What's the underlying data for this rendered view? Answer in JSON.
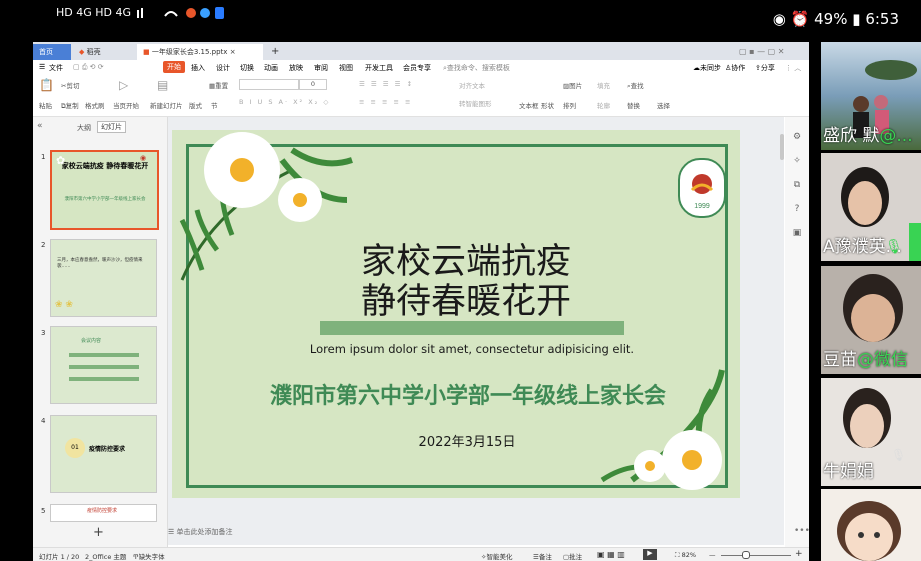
{
  "status_bar": {
    "left_icons": "HD 4G HD 4G",
    "battery": "49%",
    "time": "6:53"
  },
  "wps": {
    "tabs": [
      {
        "label": "首页"
      },
      {
        "label": "稻壳"
      },
      {
        "label": "一年级家长会3.15.pptx"
      }
    ],
    "new_tab": "+",
    "menu": [
      "文件",
      "开始",
      "插入",
      "设计",
      "切换",
      "动画",
      "放映",
      "审阅",
      "视图",
      "开发工具",
      "会员专享"
    ],
    "search_placeholder": "查找命令、搜索模板",
    "sync": "未同步",
    "collab": "协作",
    "share": "分享",
    "ribbon": {
      "paste": "粘贴",
      "cut": "剪切",
      "copy": "复制",
      "format_painter": "格式刷",
      "from_current": "当页开始",
      "new_slide": "新建幻灯片",
      "layout": "版式",
      "section": "节",
      "reset": "重置",
      "font_size": "0",
      "text_box": "文本框",
      "shape": "形状",
      "picture": "图片",
      "arrange": "排列",
      "fill": "填充",
      "outline": "轮廓",
      "find": "查找",
      "replace": "替换",
      "select": "选择",
      "align_text": "对齐文本",
      "smart_art": "转智能图形"
    },
    "panel_tabs": {
      "outline": "大纲",
      "slides": "幻灯片"
    },
    "thumbnails": [
      {
        "num": "1",
        "title": "家校云端抗疫 静待春暖花开",
        "sub": "濮阳市第六中学小学部一年级线上家长会"
      },
      {
        "num": "2",
        "text": "三月，本应春意盎然，暖声沙沙，但疫情来袭……"
      },
      {
        "num": "3",
        "title": "会议内容"
      },
      {
        "num": "4",
        "num_badge": "01",
        "title": "疫情防控要求"
      },
      {
        "num": "5",
        "title": "疫情防控要求"
      }
    ],
    "add_slide": "+",
    "notes_placeholder": "单击此处添加备注",
    "slide": {
      "title_line1": "家校云端抗疫",
      "title_line2": "静待春暖花开",
      "lorem": "Lorem ipsum dolor sit amet, consectetur adipisicing elit.",
      "subtitle": "濮阳市第六中学小学部一年级线上家长会",
      "date": "2022年3月15日",
      "logo_year": "1999"
    },
    "status": {
      "slide_count": "幻灯片 1 / 20",
      "theme": "2_Office 主题",
      "missing_font": "缺失字体",
      "beautify": "智能美化",
      "notes": "备注",
      "comments": "批注",
      "zoom": "82%"
    }
  },
  "participants": [
    {
      "name": "盛欣  默",
      "tag": "@..."
    },
    {
      "name": "A豫濮英...",
      "tag": ""
    },
    {
      "name": "豆苗",
      "tag": "@微信"
    },
    {
      "name": "牛娟娟",
      "tag": ""
    },
    {
      "name": "",
      "tag": ""
    }
  ],
  "colors": {
    "ribbon_accent": "#e8562a",
    "slide_bg": "#d6e6c3",
    "slide_green": "#3f8a55",
    "title_text": "#1a1a1a"
  }
}
